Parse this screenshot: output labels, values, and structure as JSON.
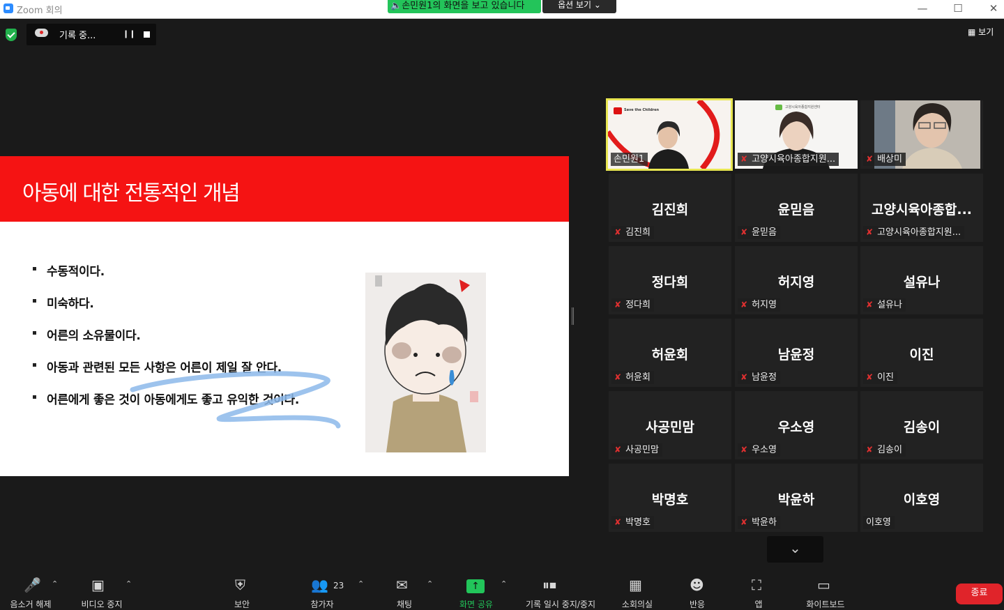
{
  "window": {
    "title": "Zoom 회의"
  },
  "share_banner": {
    "text": "손민원1의 화면을 보고 있습니다",
    "options_label": "옵션 보기 ⌄"
  },
  "recording": {
    "label": "기록 중..."
  },
  "view_button": {
    "label": "보기"
  },
  "slide": {
    "title": "아동에 대한 전통적인 개념",
    "bullets": [
      "수동적이다.",
      "미숙하다.",
      "어른의 소유물이다.",
      "아동과 관련된 모든 사항은 어른이 제일 잘 안다.",
      "어른에게 좋은 것이 아동에게도 좋고 유익한 것이다."
    ]
  },
  "gallery": {
    "video_tiles": [
      {
        "name": "손민원1",
        "muted": false,
        "active_speaker": true
      },
      {
        "name": "고양시육아종합지원...",
        "muted": true
      },
      {
        "name": "배상미",
        "muted": true
      }
    ],
    "tiles": [
      {
        "display": "김진희",
        "name": "김진희",
        "muted": true
      },
      {
        "display": "윤믿음",
        "name": "윤믿음",
        "muted": true
      },
      {
        "display": "고양시육아종합...",
        "name": "고양시육아종합지원...",
        "muted": true
      },
      {
        "display": "정다희",
        "name": "정다희",
        "muted": true
      },
      {
        "display": "허지영",
        "name": "허지영",
        "muted": true
      },
      {
        "display": "설유나",
        "name": "설유나",
        "muted": true
      },
      {
        "display": "허윤회",
        "name": "허윤회",
        "muted": true
      },
      {
        "display": "남윤정",
        "name": "남윤정",
        "muted": true
      },
      {
        "display": "이진",
        "name": "이진",
        "muted": true
      },
      {
        "display": "사공민맘",
        "name": "사공민맘",
        "muted": true
      },
      {
        "display": "우소영",
        "name": "우소영",
        "muted": true
      },
      {
        "display": "김송이",
        "name": "김송이",
        "muted": true
      },
      {
        "display": "박명호",
        "name": "박명호",
        "muted": true
      },
      {
        "display": "박윤하",
        "name": "박윤하",
        "muted": true
      },
      {
        "display": "이호영",
        "name": "이호영",
        "muted": false
      }
    ],
    "mini_slide_brand": "Save the Children",
    "mini_slide_brand2": "고양시육아종합지원센터"
  },
  "toolbar": {
    "unmute": "음소거 해제",
    "video_stop": "비디오 중지",
    "security": "보안",
    "participants": "참가자",
    "participants_count": "23",
    "chat": "채팅",
    "share": "화면 공유",
    "record": "기록 일시 중지/중지",
    "breakout": "소회의실",
    "reactions": "반응",
    "apps": "앱",
    "whiteboard": "화이트보드",
    "end": "종료"
  },
  "colors": {
    "slide_red": "#f51313",
    "share_green": "#23c45a",
    "speaker_border": "#e8e651",
    "end_red": "#e0242a"
  }
}
